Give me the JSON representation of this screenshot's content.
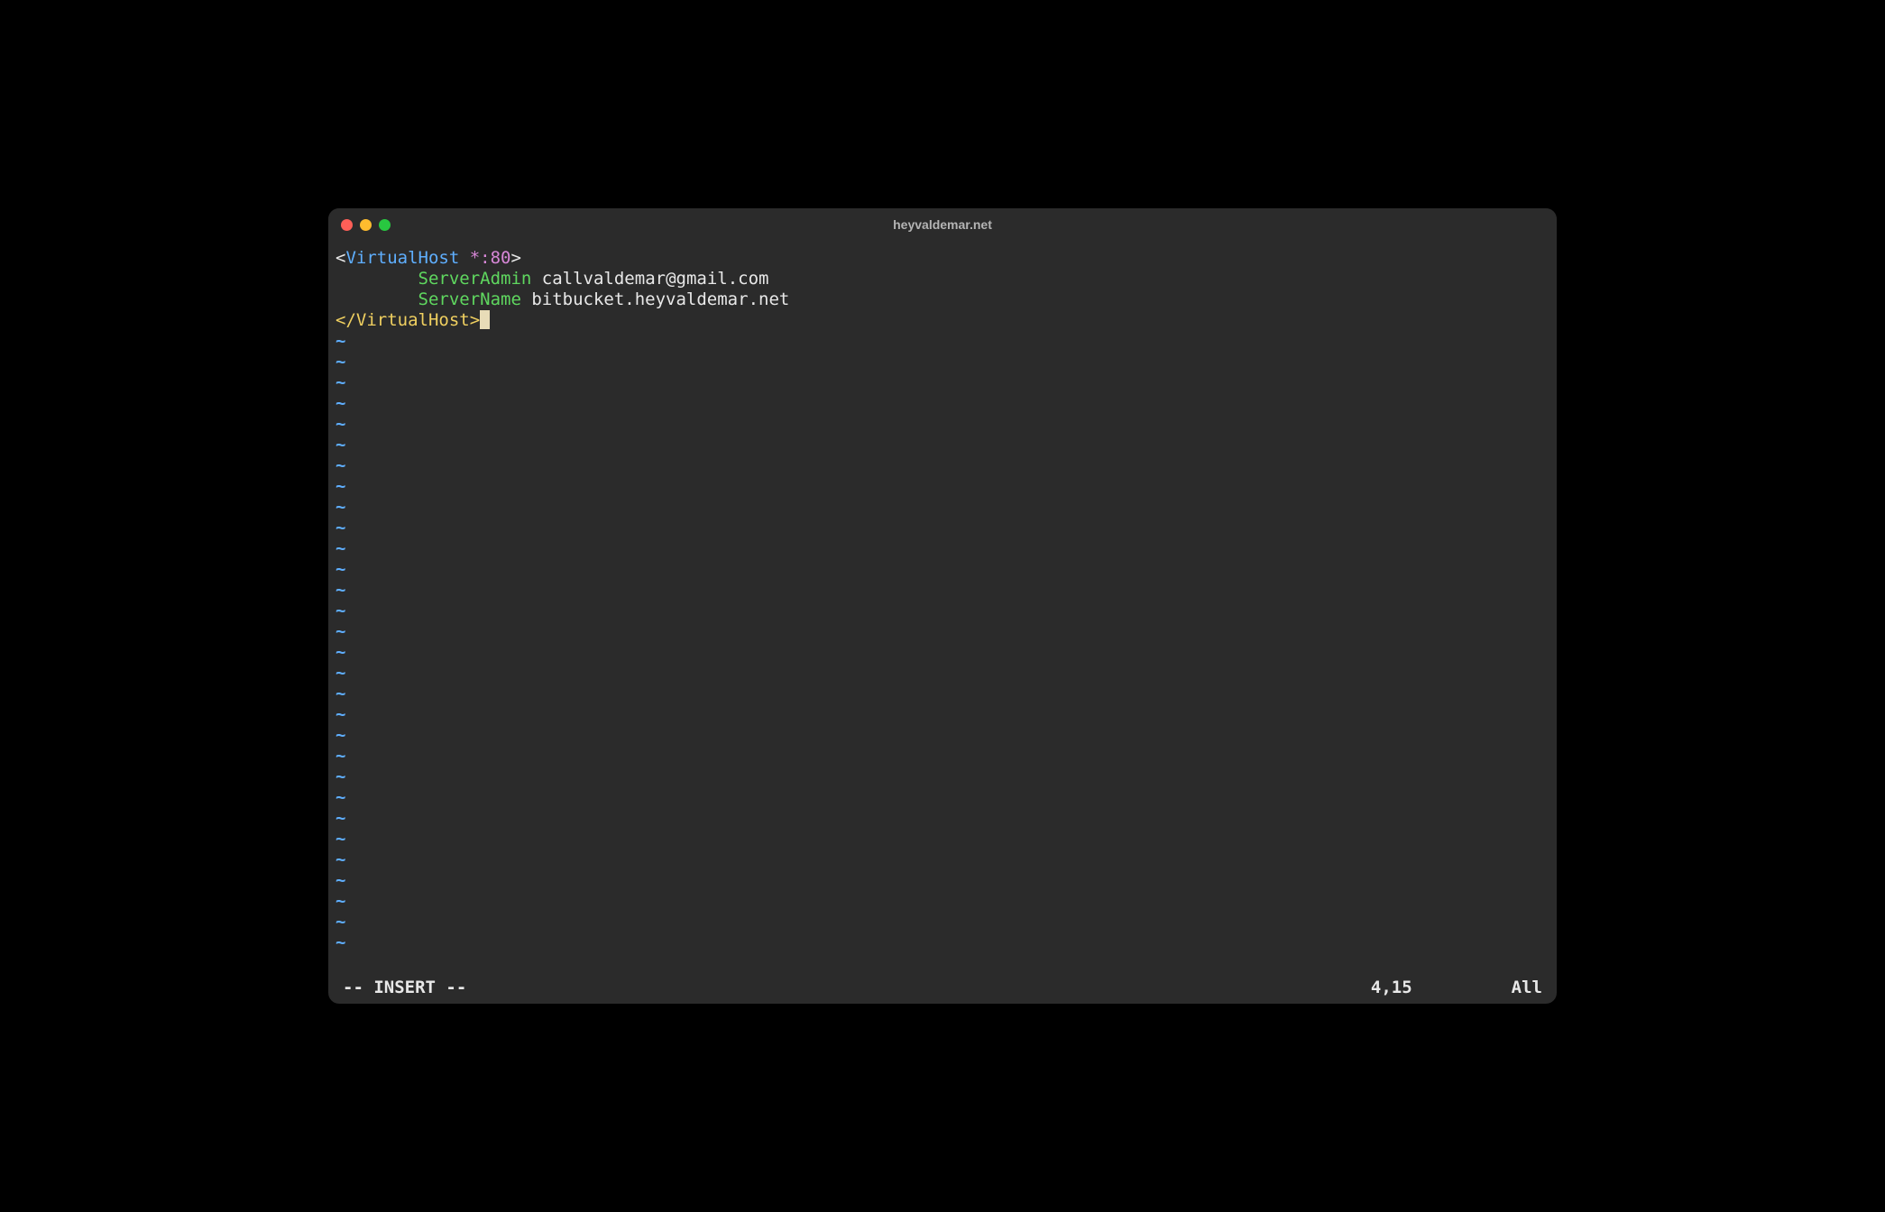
{
  "window": {
    "title": "heyvaldemar.net"
  },
  "editor": {
    "lines": [
      {
        "segments": [
          {
            "text": "<",
            "class": "tag-bracket"
          },
          {
            "text": "VirtualHost",
            "class": "tag-name"
          },
          {
            "text": " *:80",
            "class": "tag-args"
          },
          {
            "text": ">",
            "class": "tag-bracket"
          }
        ]
      },
      {
        "indent": "        ",
        "segments": [
          {
            "text": "ServerAdmin",
            "class": "directive"
          },
          {
            "text": " callvaldemar@gmail.com",
            "class": "value"
          }
        ]
      },
      {
        "indent": "        ",
        "segments": [
          {
            "text": "ServerName",
            "class": "directive"
          },
          {
            "text": " bitbucket.heyvaldemar.net",
            "class": "value"
          }
        ]
      },
      {
        "segments": [
          {
            "text": "</VirtualHost>",
            "class": "close-tag"
          }
        ],
        "cursor_after": true
      }
    ],
    "empty_line_marker": "~",
    "empty_line_count": 30
  },
  "status": {
    "mode": "-- INSERT --",
    "position": "4,15",
    "scroll": "All"
  }
}
